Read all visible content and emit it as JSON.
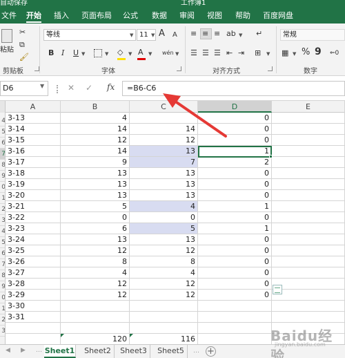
{
  "titlebar": {
    "left_text": "自动保存",
    "center_text": "工作簿1"
  },
  "tabs": [
    {
      "label": "文件"
    },
    {
      "label": "开始"
    },
    {
      "label": "插入"
    },
    {
      "label": "页面布局"
    },
    {
      "label": "公式"
    },
    {
      "label": "数据"
    },
    {
      "label": "审阅"
    },
    {
      "label": "视图"
    },
    {
      "label": "帮助"
    },
    {
      "label": "百度网盘"
    }
  ],
  "ribbon": {
    "clipboard_label": "剪贴板",
    "paste_label": "粘贴",
    "font_group_label": "字体",
    "font_name": "等线",
    "font_size": "11",
    "grow_font": "A",
    "shrink_font": "A",
    "bold": "B",
    "italic": "I",
    "underline": "U",
    "font_color_glyph": "A",
    "wen_glyph": "wén",
    "align_group_label": "对齐方式",
    "number_group_label": "数字",
    "number_format": "常规",
    "percent": "%",
    "comma": "9",
    "accent_color": "#217346"
  },
  "formula_bar": {
    "name_box": "D6",
    "cancel": "✕",
    "enter": "✓",
    "fx": "fx",
    "formula": "=B6-C6"
  },
  "columns": [
    {
      "label": "A"
    },
    {
      "label": "B"
    },
    {
      "label": "C"
    },
    {
      "label": "D"
    },
    {
      "label": "E"
    }
  ],
  "row_numbers": [
    "4",
    "5",
    "6",
    "7",
    "8",
    "9",
    "0",
    "1",
    "2",
    "3",
    "4",
    "5",
    "6",
    "7",
    "8",
    "9",
    "0",
    "1",
    "2",
    "3"
  ],
  "rows": [
    {
      "a": "3-13",
      "b": "4",
      "c": "",
      "d": "0"
    },
    {
      "a": "3-14",
      "b": "14",
      "c": "14",
      "d": "0"
    },
    {
      "a": "3-15",
      "b": "12",
      "c": "12",
      "d": "0"
    },
    {
      "a": "3-16",
      "b": "14",
      "c": "13",
      "d": "1"
    },
    {
      "a": "3-17",
      "b": "9",
      "c": "7",
      "d": "2"
    },
    {
      "a": "3-18",
      "b": "13",
      "c": "13",
      "d": "0"
    },
    {
      "a": "3-19",
      "b": "13",
      "c": "13",
      "d": "0"
    },
    {
      "a": "3-20",
      "b": "13",
      "c": "13",
      "d": "0"
    },
    {
      "a": "3-21",
      "b": "5",
      "c": "4",
      "d": "1"
    },
    {
      "a": "3-22",
      "b": "0",
      "c": "0",
      "d": "0"
    },
    {
      "a": "3-23",
      "b": "6",
      "c": "5",
      "d": "1"
    },
    {
      "a": "3-24",
      "b": "13",
      "c": "13",
      "d": "0"
    },
    {
      "a": "3-25",
      "b": "12",
      "c": "12",
      "d": "0"
    },
    {
      "a": "3-26",
      "b": "8",
      "c": "8",
      "d": "0"
    },
    {
      "a": "3-27",
      "b": "4",
      "c": "4",
      "d": "0"
    },
    {
      "a": "3-28",
      "b": "12",
      "c": "12",
      "d": "0"
    },
    {
      "a": "3-29",
      "b": "12",
      "c": "12",
      "d": "0"
    },
    {
      "a": "3-30",
      "b": "",
      "c": "",
      "d": ""
    },
    {
      "a": "3-31",
      "b": "",
      "c": "",
      "d": ""
    },
    {
      "a": "",
      "b": "",
      "c": "",
      "d": ""
    },
    {
      "a": "",
      "b": "120",
      "c": "116",
      "d": ""
    }
  ],
  "sheets": [
    {
      "label": "Sheet1"
    },
    {
      "label": "Sheet2"
    },
    {
      "label": "Sheet3"
    },
    {
      "label": "Sheet5"
    }
  ],
  "add_sheet": "+",
  "watermark": {
    "text": "Baidu经验",
    "sub": "jingyan.baidu.com"
  },
  "annotation_color": "#e53935"
}
